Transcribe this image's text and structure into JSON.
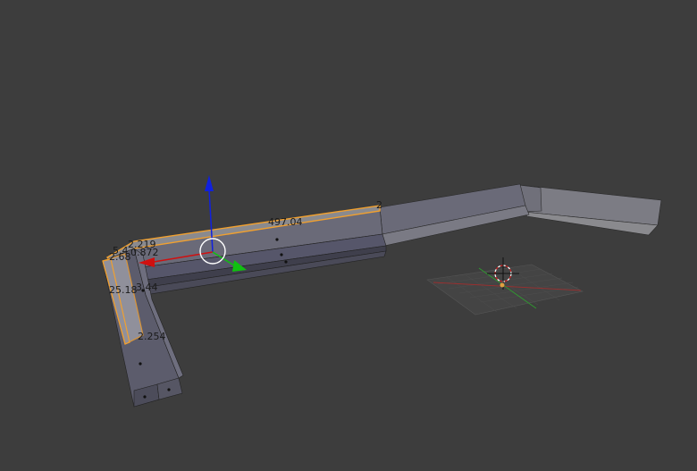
{
  "viewport": {
    "background": "#3d3d3d",
    "selection_color": "#f0a030",
    "mesh_face_color": "#6e6e7a",
    "x_axis_color": "#d01010",
    "y_axis_color": "#10c010",
    "z_axis_color": "#1020e0"
  },
  "dimension_labels": {
    "edge_length_a": "2",
    "edge_length_b": "497.04",
    "edge_length_c": "2.219",
    "edge_length_d": "2.68",
    "edge_length_e": "5.4",
    "edge_length_f": "0.872",
    "edge_length_g": "25.18",
    "edge_length_h": "3.44",
    "edge_length_i": "2.254"
  },
  "icons": {
    "transform_manipulator": "move-arrows-icon",
    "cursor": "3d-cursor-icon",
    "grid": "floor-grid-icon"
  }
}
